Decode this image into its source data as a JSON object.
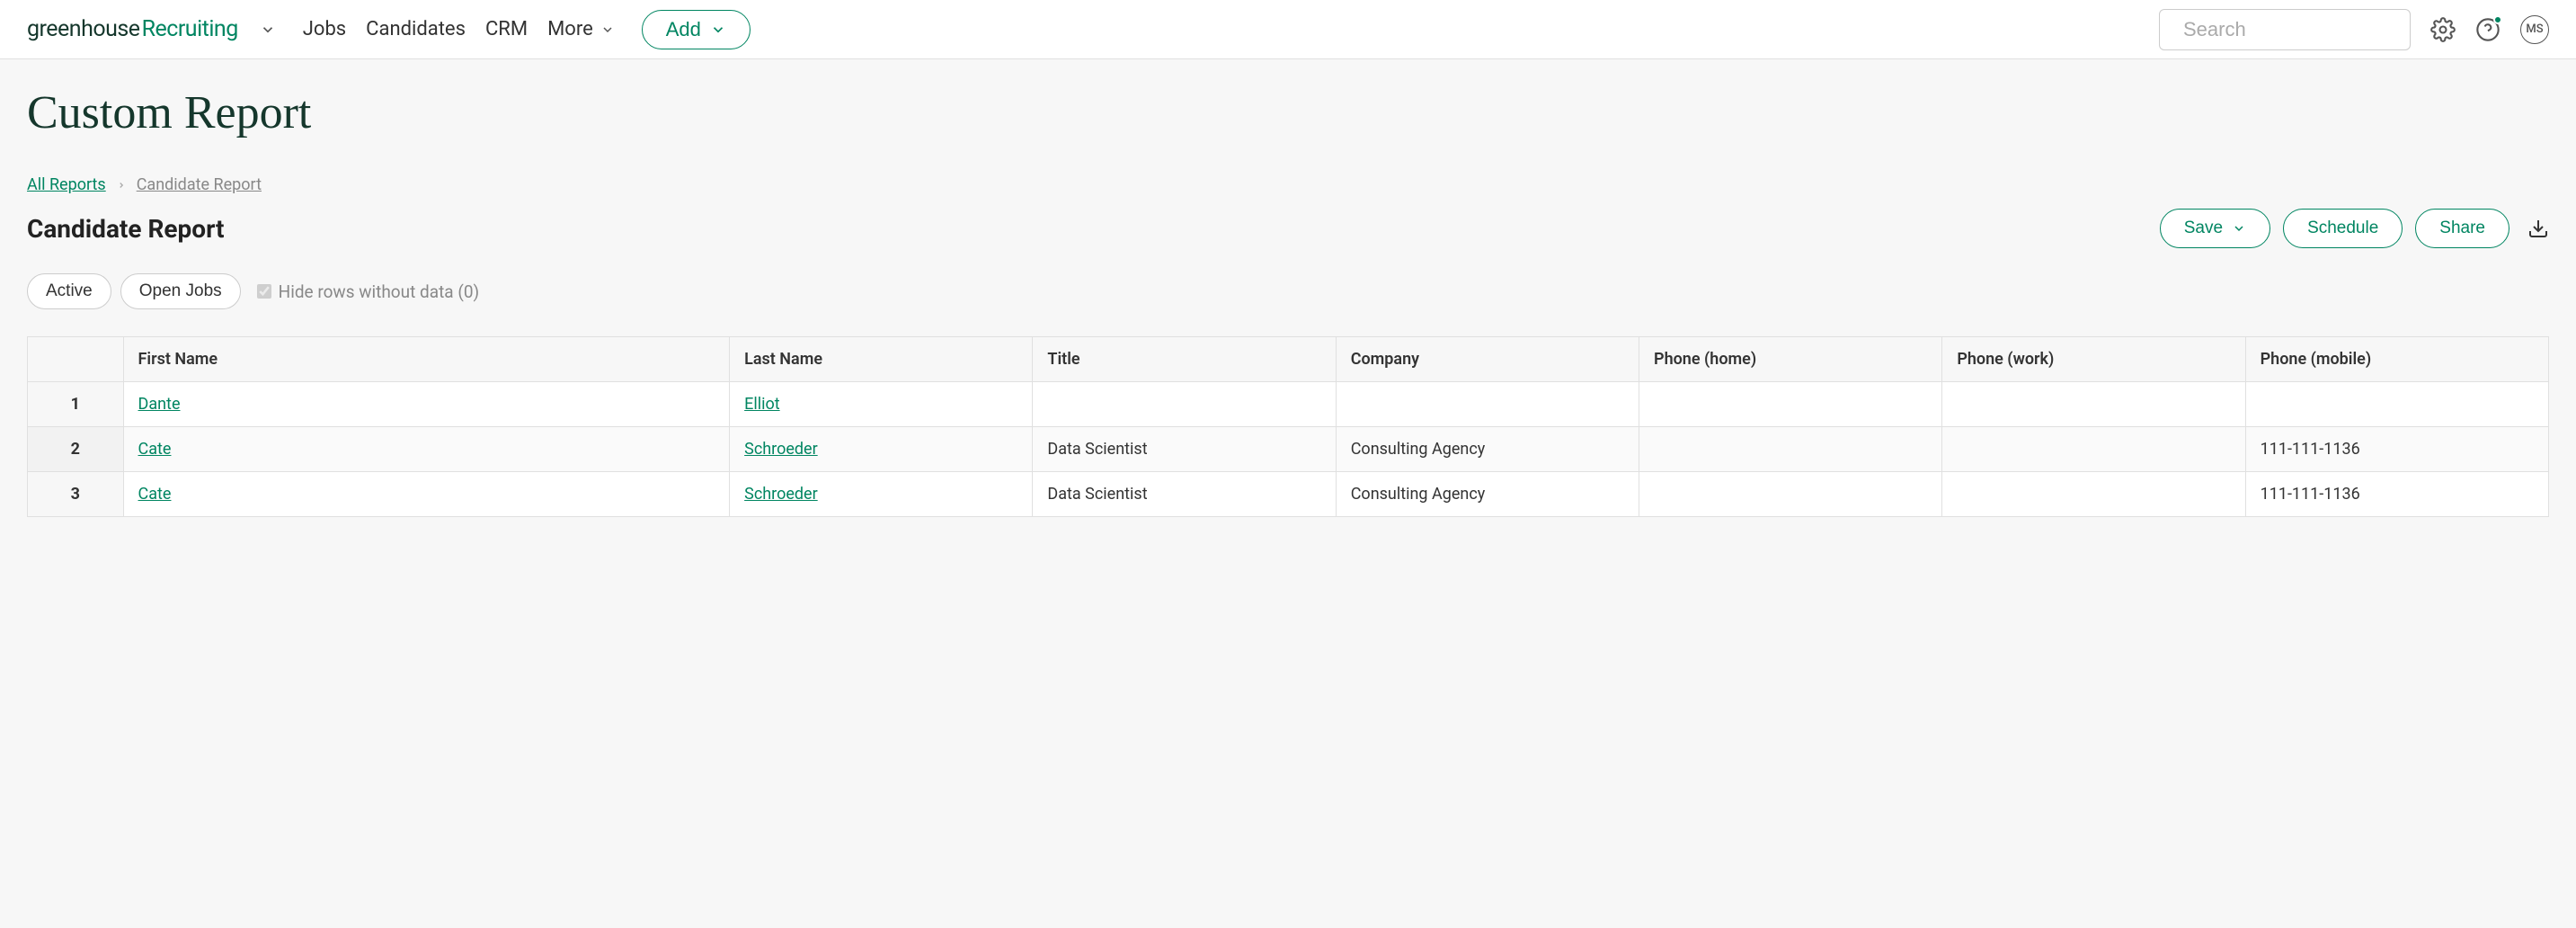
{
  "brand": {
    "part1": "greenhouse",
    "part2": "Recruiting"
  },
  "nav": {
    "jobs": "Jobs",
    "candidates": "Candidates",
    "crm": "CRM",
    "more": "More",
    "add": "Add"
  },
  "search": {
    "placeholder": "Search"
  },
  "avatar": {
    "initials": "MS"
  },
  "page": {
    "title": "Custom Report",
    "breadcrumb": {
      "root": "All Reports",
      "current": "Candidate Report"
    },
    "report_title": "Candidate Report",
    "actions": {
      "save": "Save",
      "schedule": "Schedule",
      "share": "Share"
    },
    "filters": {
      "active": "Active",
      "open_jobs": "Open Jobs",
      "hide_rows": "Hide rows without data (0)"
    }
  },
  "table": {
    "headers": {
      "first_name": "First Name",
      "last_name": "Last Name",
      "title": "Title",
      "company": "Company",
      "phone_home": "Phone (home)",
      "phone_work": "Phone (work)",
      "phone_mobile": "Phone (mobile)"
    },
    "rows": [
      {
        "n": "1",
        "first_name": "Dante",
        "last_name": "Elliot",
        "title": "",
        "company": "",
        "phone_home": "",
        "phone_work": "",
        "phone_mobile": ""
      },
      {
        "n": "2",
        "first_name": "Cate",
        "last_name": "Schroeder",
        "title": "Data Scientist",
        "company": "Consulting Agency",
        "phone_home": "",
        "phone_work": "",
        "phone_mobile": "111-111-1136"
      },
      {
        "n": "3",
        "first_name": "Cate",
        "last_name": "Schroeder",
        "title": "Data Scientist",
        "company": "Consulting Agency",
        "phone_home": "",
        "phone_work": "",
        "phone_mobile": "111-111-1136"
      }
    ]
  }
}
